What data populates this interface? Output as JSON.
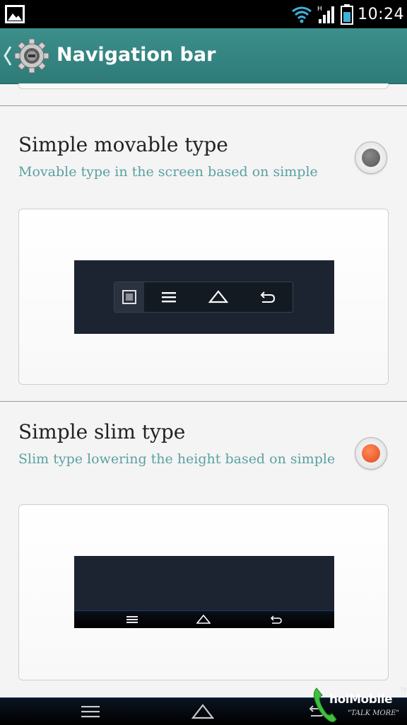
{
  "status_bar": {
    "time": "10:24",
    "icons": [
      "gallery-icon",
      "wifi-icon",
      "signal-icon",
      "battery-icon"
    ]
  },
  "action_bar": {
    "title": "Navigation bar",
    "icons": [
      "back-chevron-icon",
      "settings-gear-icon"
    ],
    "accent": "#3c8f8c"
  },
  "options": [
    {
      "title": "Simple movable type",
      "subtitle": "Movable type in the screen based on simple",
      "selected": false,
      "preview_icons": [
        "recent-apps-icon",
        "menu-icon",
        "home-icon",
        "back-icon"
      ]
    },
    {
      "title": "Simple slim type",
      "subtitle": "Slim type lowering the height based on simple",
      "selected": true,
      "preview_icons": [
        "menu-icon",
        "home-icon",
        "back-icon"
      ]
    }
  ],
  "colors": {
    "subtitle": "#5aa0a2",
    "radio_selected": "#e24a1d",
    "radio_unselected": "#6a6a6a",
    "preview_screen": "#1c2432"
  },
  "system_nav": {
    "icons": [
      "menu-icon",
      "home-icon",
      "back-icon"
    ]
  },
  "watermark": {
    "text": "hoiMobile",
    "tagline": "\"TALK MORE\"",
    "tm": "TM"
  }
}
